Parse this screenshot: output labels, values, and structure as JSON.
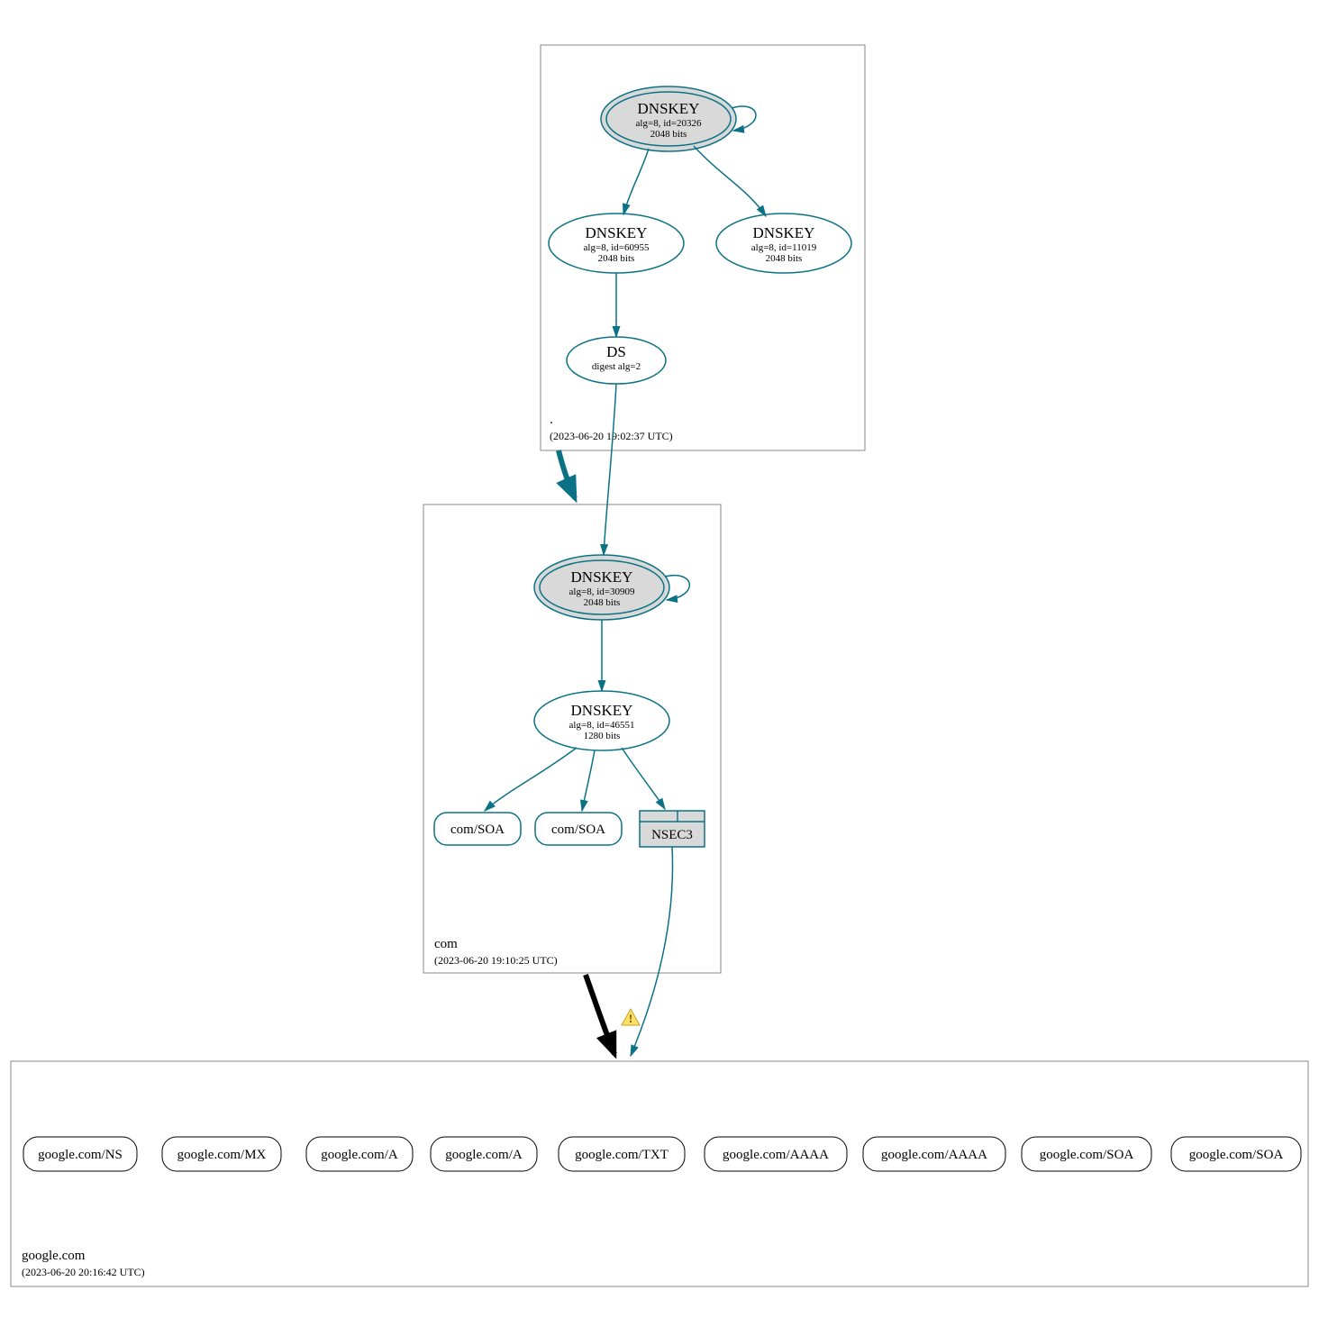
{
  "chart_data": {
    "type": "diagram",
    "description": "DNSSEC authentication chain / DNSViz-style delegation graph for google.com",
    "zones": [
      {
        "name": ".",
        "timestamp": "2023-06-20 19:02:37 UTC",
        "nodes": [
          {
            "id": "root-ksk",
            "type": "DNSKEY",
            "ksk": true,
            "alg": 8,
            "keyid": 20326,
            "bits": 2048
          },
          {
            "id": "root-zsk1",
            "type": "DNSKEY",
            "ksk": false,
            "alg": 8,
            "keyid": 60955,
            "bits": 2048
          },
          {
            "id": "root-zsk2",
            "type": "DNSKEY",
            "ksk": false,
            "alg": 8,
            "keyid": 11019,
            "bits": 2048
          },
          {
            "id": "root-ds",
            "type": "DS",
            "digest_alg": 2
          }
        ],
        "edges": [
          [
            "root-ksk",
            "root-ksk"
          ],
          [
            "root-ksk",
            "root-zsk1"
          ],
          [
            "root-ksk",
            "root-zsk2"
          ],
          [
            "root-zsk1",
            "root-ds"
          ]
        ]
      },
      {
        "name": "com",
        "timestamp": "2023-06-20 19:10:25 UTC",
        "nodes": [
          {
            "id": "com-ksk",
            "type": "DNSKEY",
            "ksk": true,
            "alg": 8,
            "keyid": 30909,
            "bits": 2048
          },
          {
            "id": "com-zsk",
            "type": "DNSKEY",
            "ksk": false,
            "alg": 8,
            "keyid": 46551,
            "bits": 1280
          },
          {
            "id": "com-soa1",
            "type": "RRSET",
            "label": "com/SOA"
          },
          {
            "id": "com-soa2",
            "type": "RRSET",
            "label": "com/SOA"
          },
          {
            "id": "com-nsec3",
            "type": "NSEC3",
            "label": "NSEC3"
          }
        ],
        "edges": [
          [
            "root-ds",
            "com-ksk"
          ],
          [
            "com-ksk",
            "com-ksk"
          ],
          [
            "com-ksk",
            "com-zsk"
          ],
          [
            "com-zsk",
            "com-soa1"
          ],
          [
            "com-zsk",
            "com-soa2"
          ],
          [
            "com-zsk",
            "com-nsec3"
          ]
        ]
      },
      {
        "name": "google.com",
        "timestamp": "2023-06-20 20:16:42 UTC",
        "nodes": [
          {
            "id": "g-ns",
            "type": "RRSET",
            "label": "google.com/NS"
          },
          {
            "id": "g-mx",
            "type": "RRSET",
            "label": "google.com/MX"
          },
          {
            "id": "g-a1",
            "type": "RRSET",
            "label": "google.com/A"
          },
          {
            "id": "g-a2",
            "type": "RRSET",
            "label": "google.com/A"
          },
          {
            "id": "g-txt",
            "type": "RRSET",
            "label": "google.com/TXT"
          },
          {
            "id": "g-aaaa1",
            "type": "RRSET",
            "label": "google.com/AAAA"
          },
          {
            "id": "g-aaaa2",
            "type": "RRSET",
            "label": "google.com/AAAA"
          },
          {
            "id": "g-soa1",
            "type": "RRSET",
            "label": "google.com/SOA"
          },
          {
            "id": "g-soa2",
            "type": "RRSET",
            "label": "google.com/SOA"
          }
        ],
        "delegation_edges": [
          {
            "from": "com",
            "to": "google.com",
            "warning": true
          },
          {
            "from": "com-nsec3",
            "to": "google.com"
          }
        ]
      }
    ]
  },
  "zones": {
    "root": {
      "label": ".",
      "ts": "(2023-06-20 19:02:37 UTC)"
    },
    "com": {
      "label": "com",
      "ts": "(2023-06-20 19:10:25 UTC)"
    },
    "google": {
      "label": "google.com",
      "ts": "(2023-06-20 20:16:42 UTC)"
    }
  },
  "nodes": {
    "root_ksk": {
      "t": "DNSKEY",
      "l2": "alg=8, id=20326",
      "l3": "2048 bits"
    },
    "root_zsk1": {
      "t": "DNSKEY",
      "l2": "alg=8, id=60955",
      "l3": "2048 bits"
    },
    "root_zsk2": {
      "t": "DNSKEY",
      "l2": "alg=8, id=11019",
      "l3": "2048 bits"
    },
    "root_ds": {
      "t": "DS",
      "l2": "digest alg=2"
    },
    "com_ksk": {
      "t": "DNSKEY",
      "l2": "alg=8, id=30909",
      "l3": "2048 bits"
    },
    "com_zsk": {
      "t": "DNSKEY",
      "l2": "alg=8, id=46551",
      "l3": "1280 bits"
    },
    "com_soa1": {
      "t": "com/SOA"
    },
    "com_soa2": {
      "t": "com/SOA"
    },
    "com_nsec3": {
      "t": "NSEC3"
    },
    "g_ns": {
      "t": "google.com/NS"
    },
    "g_mx": {
      "t": "google.com/MX"
    },
    "g_a1": {
      "t": "google.com/A"
    },
    "g_a2": {
      "t": "google.com/A"
    },
    "g_txt": {
      "t": "google.com/TXT"
    },
    "g_aaaa1": {
      "t": "google.com/AAAA"
    },
    "g_aaaa2": {
      "t": "google.com/AAAA"
    },
    "g_soa1": {
      "t": "google.com/SOA"
    },
    "g_soa2": {
      "t": "google.com/SOA"
    }
  }
}
